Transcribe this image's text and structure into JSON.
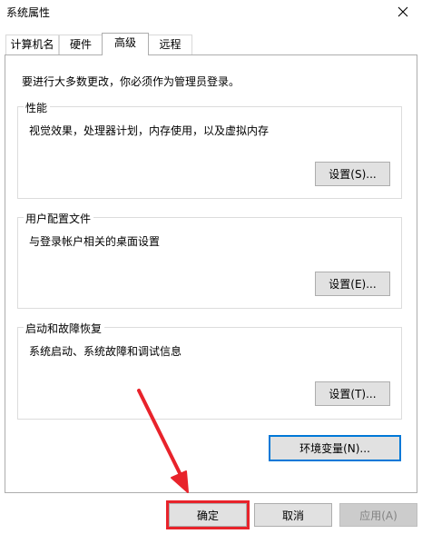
{
  "window": {
    "title": "系统属性"
  },
  "tabs": [
    {
      "label": "计算机名"
    },
    {
      "label": "硬件"
    },
    {
      "label": "高级",
      "selected": true
    },
    {
      "label": "远程"
    }
  ],
  "advanced": {
    "admin_note": "要进行大多数更改，你必须作为管理员登录。",
    "performance": {
      "title": "性能",
      "description": "视觉效果，处理器计划，内存使用，以及虚拟内存",
      "button": "设置(S)..."
    },
    "user_profiles": {
      "title": "用户配置文件",
      "description": "与登录帐户相关的桌面设置",
      "button": "设置(E)..."
    },
    "startup_recovery": {
      "title": "启动和故障恢复",
      "description": "系统启动、系统故障和调试信息",
      "button": "设置(T)..."
    },
    "env_button": "环境变量(N)..."
  },
  "footer": {
    "ok": "确定",
    "cancel": "取消",
    "apply": "应用(A)"
  },
  "colors": {
    "annotation_red": "#e8232b",
    "focus_blue": "#0078d7"
  },
  "annotation": {
    "type": "arrow",
    "target": "ok-button"
  }
}
